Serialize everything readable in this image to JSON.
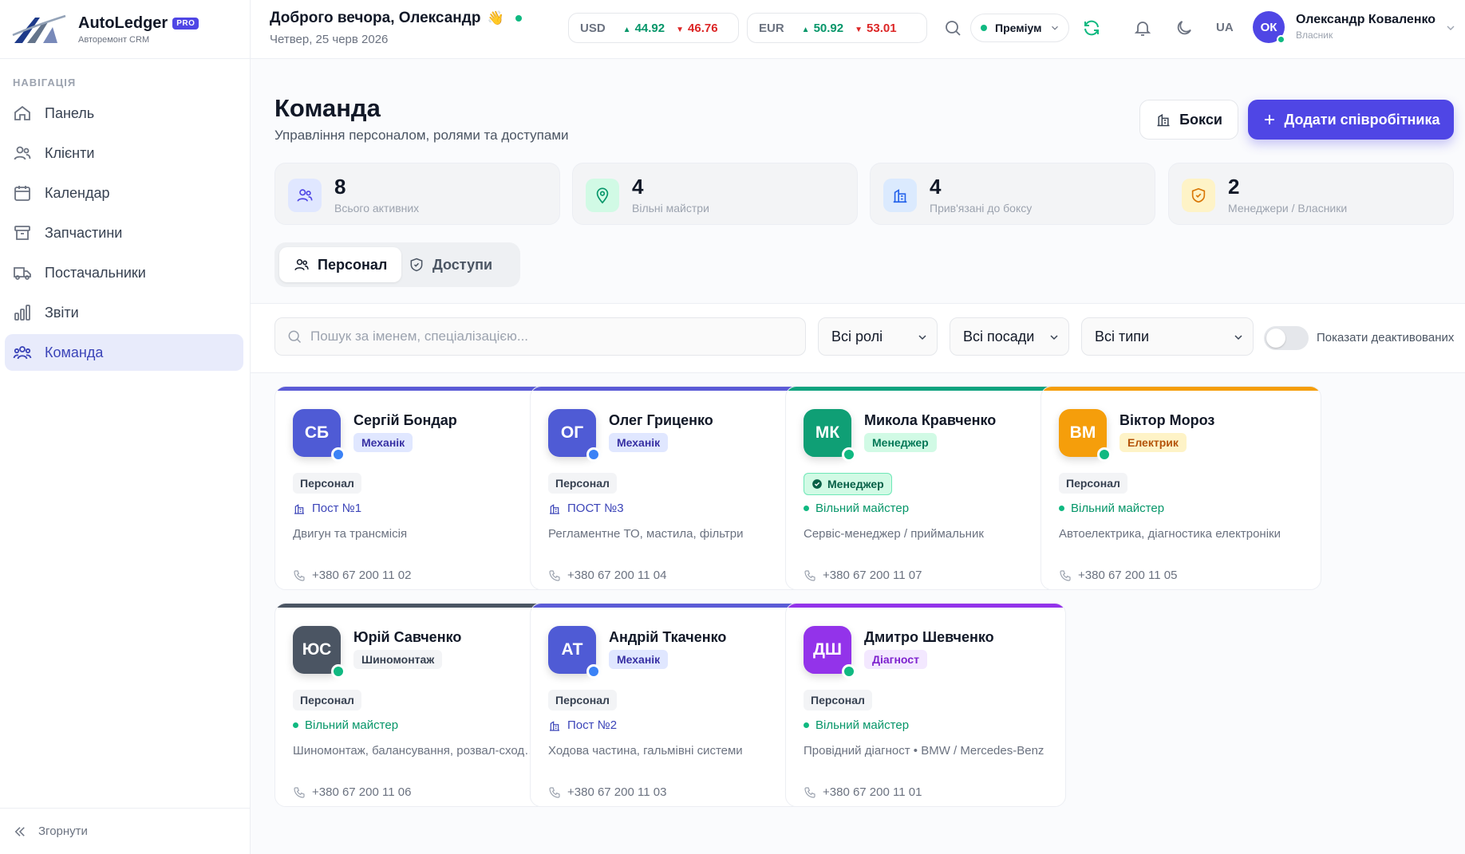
{
  "brand": {
    "name": "AutoLedger",
    "badge": "PRO",
    "subtitle": "Авторемонт CRM"
  },
  "sidebar": {
    "heading": "НАВІГАЦІЯ",
    "items": [
      {
        "label": "Панель",
        "icon": "home-icon"
      },
      {
        "label": "Клієнти",
        "icon": "users-icon"
      },
      {
        "label": "Календар",
        "icon": "calendar-icon"
      },
      {
        "label": "Запчастини",
        "icon": "archive-icon"
      },
      {
        "label": "Постачальники",
        "icon": "truck-icon"
      },
      {
        "label": "Звіти",
        "icon": "bar-chart-icon"
      },
      {
        "label": "Команда",
        "icon": "team-icon",
        "active": true
      }
    ],
    "collapse_label": "Згорнути"
  },
  "topbar": {
    "greeting": "Доброго вечора, Олександр",
    "greeting_emoji": "👋",
    "date": "Четвер, 25 черв 2026",
    "fx": [
      {
        "currency": "USD",
        "buy": "44.92",
        "sell": "46.76"
      },
      {
        "currency": "EUR",
        "buy": "50.92",
        "sell": "53.01"
      }
    ],
    "plan": "Преміум",
    "lang": "UA",
    "user": {
      "initials": "ОК",
      "name": "Олександр Коваленко",
      "role": "Власник"
    }
  },
  "page": {
    "title": "Команда",
    "subtitle": "Управління персоналом, ролями та доступами",
    "boxes_button": "Бокси",
    "add_button": "Додати співробітника"
  },
  "stats": [
    {
      "value": "8",
      "label": "Всього активних",
      "icon": "users-icon",
      "bg": "#e0e7ff",
      "fg": "#4f46e5"
    },
    {
      "value": "4",
      "label": "Вільні майстри",
      "icon": "pin-icon",
      "bg": "#d1fae5",
      "fg": "#059669"
    },
    {
      "value": "4",
      "label": "Прив'язані до боксу",
      "icon": "building-icon",
      "bg": "#dbeafe",
      "fg": "#2563eb"
    },
    {
      "value": "2",
      "label": "Менеджери / Власники",
      "icon": "shield-icon",
      "bg": "#fef3c7",
      "fg": "#d97706"
    }
  ],
  "tabs": [
    {
      "label": "Персонал",
      "active": true
    },
    {
      "label": "Доступи",
      "active": false
    }
  ],
  "filters": {
    "search_placeholder": "Пошук за іменем, спеціалізацією...",
    "roles": "Всі ролі",
    "positions": "Всі посади",
    "types": "Всі типи",
    "show_deactivated": "Показати деактивованих",
    "show_deactivated_on": false
  },
  "employees": [
    {
      "initials": "СБ",
      "name": "Сергій Бондар",
      "role": "Механік",
      "type": "Персонал",
      "post": "Пост №1",
      "post_kind": "boxed",
      "spec": "Двигун та трансмісія",
      "phone": "+380 67 200 11 02",
      "bar": "#5b5bd6",
      "avatar": "#4f5bd5",
      "status": "#3b82f6",
      "role_bg": "#e0e7ff",
      "role_fg": "#3730a3"
    },
    {
      "initials": "ОГ",
      "name": "Олег Гриценко",
      "role": "Механік",
      "type": "Персонал",
      "post": "ПОСТ №3",
      "post_kind": "boxed",
      "spec": "Регламентне ТО, мастила, фільтри",
      "phone": "+380 67 200 11 04",
      "bar": "#5b5bd6",
      "avatar": "#4f5bd5",
      "status": "#3b82f6",
      "role_bg": "#e0e7ff",
      "role_fg": "#3730a3"
    },
    {
      "initials": "МК",
      "name": "Микола Кравченко",
      "role": "Менеджер",
      "type": "Менеджер",
      "type_kind": "mgr",
      "post": "Вільний майстер",
      "post_kind": "free",
      "spec": "Сервіс-менеджер / приймальник",
      "phone": "+380 67 200 11 07",
      "bar": "#10a37f",
      "avatar": "#0f9f75",
      "status": "#10b981",
      "role_bg": "#d1fae5",
      "role_fg": "#047857"
    },
    {
      "initials": "ВМ",
      "name": "Віктор Мороз",
      "role": "Електрик",
      "type": "Персонал",
      "post": "Вільний майстер",
      "post_kind": "free",
      "spec": "Автоелектрика, діагностика електроніки",
      "phone": "+380 67 200 11 05",
      "bar": "#f59e0b",
      "avatar": "#f59e0b",
      "status": "#10b981",
      "role_bg": "#fef3c7",
      "role_fg": "#b45309"
    },
    {
      "initials": "ЮС",
      "name": "Юрій Савченко",
      "role": "Шиномонтаж",
      "type": "Персонал",
      "post": "Вільний майстер",
      "post_kind": "free",
      "spec": "Шиномонтаж, балансування, розвал-сходження",
      "phone": "+380 67 200 11 06",
      "bar": "#4b5563",
      "avatar": "#4b5563",
      "status": "#10b981",
      "role_bg": "#f3f4f6",
      "role_fg": "#374151"
    },
    {
      "initials": "АТ",
      "name": "Андрій Ткаченко",
      "role": "Механік",
      "type": "Персонал",
      "post": "Пост №2",
      "post_kind": "boxed",
      "spec": "Ходова частина, гальмівні системи",
      "phone": "+380 67 200 11 03",
      "bar": "#5b5bd6",
      "avatar": "#4f5bd5",
      "status": "#3b82f6",
      "role_bg": "#e0e7ff",
      "role_fg": "#3730a3"
    },
    {
      "initials": "ДШ",
      "name": "Дмитро Шевченко",
      "role": "Діагност",
      "type": "Персонал",
      "post": "Вільний майстер",
      "post_kind": "free",
      "spec": "Провідний діагност • BMW / Mercedes-Benz",
      "phone": "+380 67 200 11 01",
      "bar": "#9333ea",
      "avatar": "#9333ea",
      "status": "#10b981",
      "role_bg": "#f3e8ff",
      "role_fg": "#7e22ce"
    }
  ]
}
